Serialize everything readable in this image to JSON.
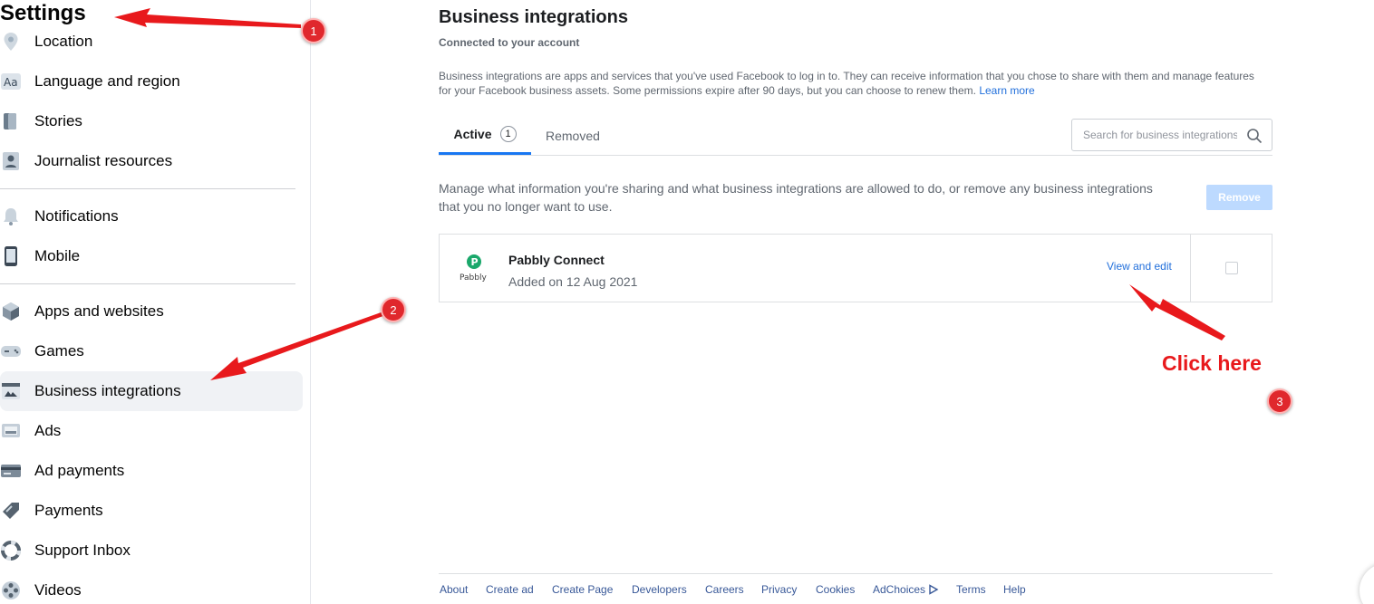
{
  "sidebar": {
    "title": "Settings",
    "items": [
      {
        "label": "Location",
        "icon": "location-pin-icon"
      },
      {
        "label": "Language and region",
        "icon": "language-aa-icon"
      },
      {
        "label": "Stories",
        "icon": "stories-book-icon"
      },
      {
        "label": "Journalist resources",
        "icon": "journalist-id-icon"
      },
      {
        "label": "Notifications",
        "icon": "bell-icon"
      },
      {
        "label": "Mobile",
        "icon": "mobile-phone-icon"
      },
      {
        "label": "Apps and websites",
        "icon": "cube-icon"
      },
      {
        "label": "Games",
        "icon": "gamepad-icon"
      },
      {
        "label": "Business integrations",
        "icon": "business-integrations-icon"
      },
      {
        "label": "Ads",
        "icon": "ads-monitor-icon"
      },
      {
        "label": "Ad payments",
        "icon": "credit-card-icon"
      },
      {
        "label": "Payments",
        "icon": "payments-tag-icon"
      },
      {
        "label": "Support Inbox",
        "icon": "lifebuoy-icon"
      },
      {
        "label": "Videos",
        "icon": "film-reel-icon"
      }
    ]
  },
  "main": {
    "title": "Business integrations",
    "subtitle": "Connected to your account",
    "description": "Business integrations are apps and services that you've used Facebook to log in to. They can receive information that you chose to share with them and manage features for your Facebook business assets. Some permissions expire after 90 days, but you can choose to renew them.",
    "learn_more": "Learn more",
    "tabs": {
      "active_label": "Active",
      "active_count": "1",
      "removed_label": "Removed"
    },
    "search": {
      "placeholder": "Search for business integrations",
      "value": ""
    },
    "manage_text": "Manage what information you're sharing and what business integrations are allowed to do, or remove any business integrations that you no longer want to use.",
    "remove_label": "Remove",
    "integration": {
      "logo_text": "Pabbly",
      "name": "Pabbly Connect",
      "added": "Added on 12 Aug 2021",
      "action": "View and edit",
      "checked": false
    }
  },
  "footer": {
    "links": [
      "About",
      "Create ad",
      "Create Page",
      "Developers",
      "Careers",
      "Privacy",
      "Cookies",
      "AdChoices",
      "Terms",
      "Help"
    ]
  },
  "annotations": {
    "badges": [
      "1",
      "2",
      "3"
    ],
    "click_here": "Click here",
    "arrow_color": "#e8191c"
  },
  "colors": {
    "accent": "#1877f2",
    "link": "#216fdb",
    "remove_button": "#bddaff",
    "active_nav_bg": "#f0f2f5",
    "pabbly_green": "#1aa86b"
  }
}
